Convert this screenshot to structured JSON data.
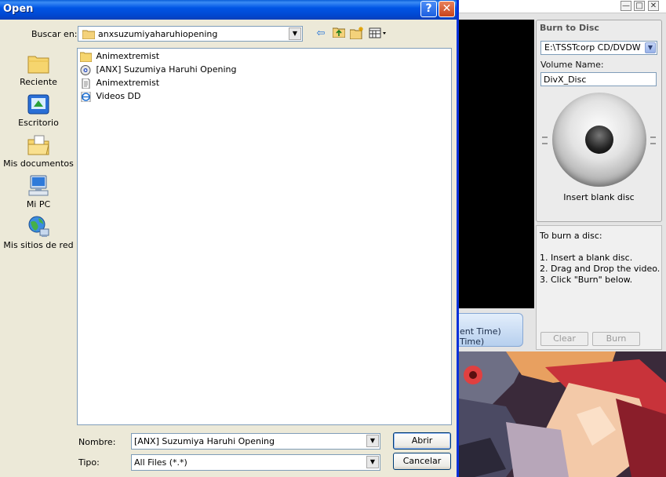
{
  "dialog": {
    "title": "Open",
    "help_glyph": "?",
    "close_glyph": "✕",
    "look_in_label": "Buscar en:",
    "look_in_value": "anxsuzumiyaharuhiopening",
    "places": [
      {
        "label": "Reciente",
        "icon": "recent-folder-icon"
      },
      {
        "label": "Escritorio",
        "icon": "desktop-icon"
      },
      {
        "label": "Mis documentos",
        "icon": "my-documents-icon"
      },
      {
        "label": "Mi PC",
        "icon": "my-computer-icon"
      },
      {
        "label": "Mis sitios de red",
        "icon": "network-places-icon"
      }
    ],
    "files": [
      {
        "name": "Animextremist",
        "icon": "folder-icon"
      },
      {
        "name": "[ANX] Suzumiya Haruhi Opening",
        "icon": "media-file-icon"
      },
      {
        "name": "Animextremist",
        "icon": "text-file-icon"
      },
      {
        "name": "Videos DD",
        "icon": "internet-shortcut-icon"
      }
    ],
    "file_name_label": "Nombre:",
    "file_name_value": "[ANX] Suzumiya Haruhi Opening",
    "file_type_label": "Tipo:",
    "file_type_value": "All Files (*.*)",
    "open_button": "Abrir",
    "cancel_button": "Cancelar"
  },
  "background_app": {
    "window_buttons": [
      "—",
      "□",
      "✕"
    ],
    "time_lines": [
      "ent Time)",
      "Time)"
    ],
    "burn_panel": {
      "title": "Burn to Disc",
      "drive": "E:\\TSSTcorp CD/DVDW",
      "volume_label": "Volume Name:",
      "volume_value": "DivX_Disc",
      "disc_status": "Insert blank disc"
    },
    "instructions": {
      "title": "To burn a disc:",
      "steps": [
        "1. Insert a blank disc.",
        "2. Drag and Drop the video.",
        "3. Click \"Burn\" below."
      ],
      "clear_button": "Clear",
      "burn_button": "Burn"
    }
  },
  "colors": {
    "titlebar": "#0055e5",
    "dialog_bg": "#ece9d8",
    "field_border": "#7f9db9"
  }
}
